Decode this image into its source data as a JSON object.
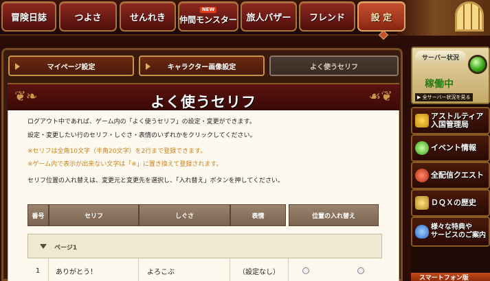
{
  "nav": {
    "tabs": [
      {
        "label": "冒険日誌"
      },
      {
        "label": "つよさ"
      },
      {
        "label": "せんれき"
      },
      {
        "label": "仲間モンスター",
        "badge": "NEW"
      },
      {
        "label": "旅人バザー"
      },
      {
        "label": "フレンド"
      },
      {
        "label": "設 定"
      }
    ]
  },
  "subtabs": [
    {
      "label": "マイページ設定"
    },
    {
      "label": "キャラクター画像設定"
    },
    {
      "label": "よく使うセリフ"
    }
  ],
  "page": {
    "title": "よく使うセリフ",
    "desc1": "ログアウト中であれば、ゲーム内の「よく使うセリフ」の設定・変更ができます。",
    "desc2": "設定・変更したい行のセリフ・しぐさ・表情のいずれかをクリックしてください。",
    "note1": "※セリフは全角10文字（半角20文字）を2行まで登録できます。",
    "note2": "※ゲーム内で表示が出来ない文字は「※」に置き換えて登録されます。",
    "desc3": "セリフ位置の入れ替えは、変更元と変更先を選択し、「入れ替え」ボタンを押してください。"
  },
  "table": {
    "headers": [
      "番号",
      "セリフ",
      "しぐさ",
      "表情",
      "位置の入れ替え"
    ],
    "page_label": "ページ1",
    "rows": [
      {
        "no": "1",
        "serif": "ありがとう！",
        "shigusa": "よろこぶ",
        "hyoujo": "（設定なし）"
      }
    ]
  },
  "sidebar": {
    "server_label": "サーバー状況",
    "server_status": "稼働中",
    "server_link": "▶ 全サーバー状況を見る",
    "buttons": [
      {
        "label": "アストルティア入国管理局",
        "line1": "アストルティア",
        "line2": "入国管理局"
      },
      {
        "label": "イベント情報"
      },
      {
        "label": "全配信クエスト"
      },
      {
        "label": "ＤＱＸの歴史"
      },
      {
        "label": "様々な特典やサービスのご案内",
        "line1": "様々な特典や",
        "line2": "サービスのご案内"
      }
    ],
    "smartphone": "スマートフォン版"
  },
  "colors": {
    "accent": "#a6381e",
    "status_green": "#2a7a14",
    "note_orange": "#c8841e"
  }
}
